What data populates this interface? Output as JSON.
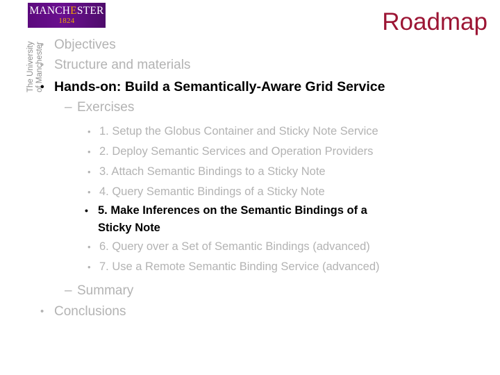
{
  "slide": {
    "title": "Roadmap",
    "title_color": "#9c1534",
    "background_color": "#ffffff",
    "dim_text_color": "#b3b3b3",
    "emphasis_text_color": "#000000"
  },
  "logo": {
    "brand_prefix": "MANCH",
    "brand_highlight": "E",
    "brand_suffix": "STER",
    "full_wordmark": "MANCHESTER",
    "year": "1824",
    "vertical_line_1": "The University",
    "vertical_line_2": "of Manchester",
    "badge_color": "#660099",
    "accent_color": "#f0a500"
  },
  "outline": {
    "items": [
      {
        "level": 1,
        "marker": "•",
        "text": "Objectives",
        "emphasis": false
      },
      {
        "level": 1,
        "marker": "•",
        "text": "Structure and materials",
        "emphasis": false
      },
      {
        "level": 1,
        "marker": "•",
        "text": "Hands-on: Build a Semantically-Aware Grid Service",
        "emphasis": true
      },
      {
        "level": 2,
        "marker": "–",
        "text": "Exercises",
        "emphasis": false
      },
      {
        "level": 3,
        "marker": "•",
        "text": "1. Setup the Globus Container and Sticky Note Service",
        "emphasis": false
      },
      {
        "level": 3,
        "marker": "•",
        "text": "2. Deploy Semantic Services and Operation Providers",
        "emphasis": false
      },
      {
        "level": 3,
        "marker": "•",
        "text": "3. Attach Semantic Bindings to a Sticky Note",
        "emphasis": false
      },
      {
        "level": 3,
        "marker": "•",
        "text": "4. Query Semantic Bindings of a Sticky Note",
        "emphasis": false
      },
      {
        "level": 3,
        "marker": "•",
        "text": "5. Make Inferences on the Semantic Bindings of a Sticky Note",
        "emphasis": true
      },
      {
        "level": 3,
        "marker": "•",
        "text": "6. Query over a Set of Semantic Bindings (advanced)",
        "emphasis": false
      },
      {
        "level": 3,
        "marker": "•",
        "text": "7. Use a Remote Semantic Binding Service (advanced)",
        "emphasis": false
      },
      {
        "level": 2,
        "marker": "–",
        "text": "Summary",
        "emphasis": false
      },
      {
        "level": 1,
        "marker": "•",
        "text": "Conclusions",
        "emphasis": false
      }
    ]
  }
}
